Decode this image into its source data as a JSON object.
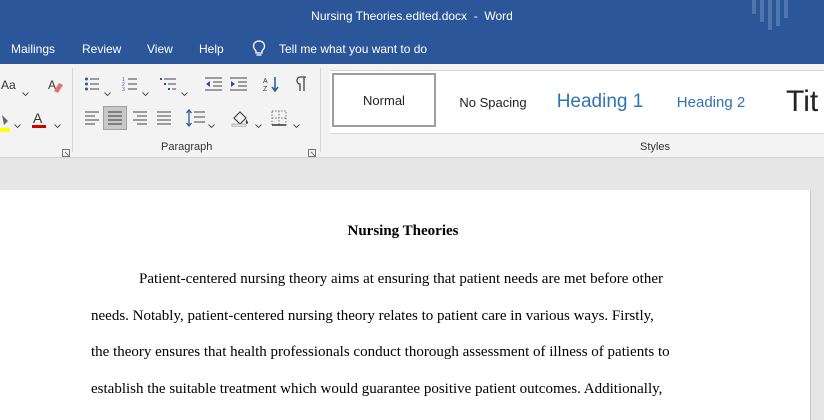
{
  "window": {
    "title": "Nursing Theories.edited.docx  -  Word"
  },
  "menu": {
    "items": [
      "Mailings",
      "Review",
      "View",
      "Help"
    ],
    "tell_me": "Tell me what you want to do"
  },
  "ribbon": {
    "font_group": {
      "change_case": "Aa"
    },
    "paragraph_group": {
      "label": "Paragraph"
    },
    "styles_group": {
      "label": "Styles",
      "styles": [
        "Normal",
        "No Spacing",
        "Heading 1",
        "Heading 2",
        "Tit"
      ],
      "selected": "Normal"
    },
    "colors": {
      "highlight": "#ffff00",
      "font_color": "#d00000",
      "accent": "#2b579a"
    }
  },
  "document": {
    "title": "Nursing Theories",
    "lines": [
      "Patient-centered nursing theory aims at ensuring that patient needs are met before other",
      "needs. Notably, patient-centered nursing theory relates to patient care in various ways. Firstly,",
      "the theory ensures that health professionals conduct thorough assessment of illness of patients to",
      "establish the suitable treatment which would guarantee positive patient outcomes. Additionally,"
    ]
  }
}
